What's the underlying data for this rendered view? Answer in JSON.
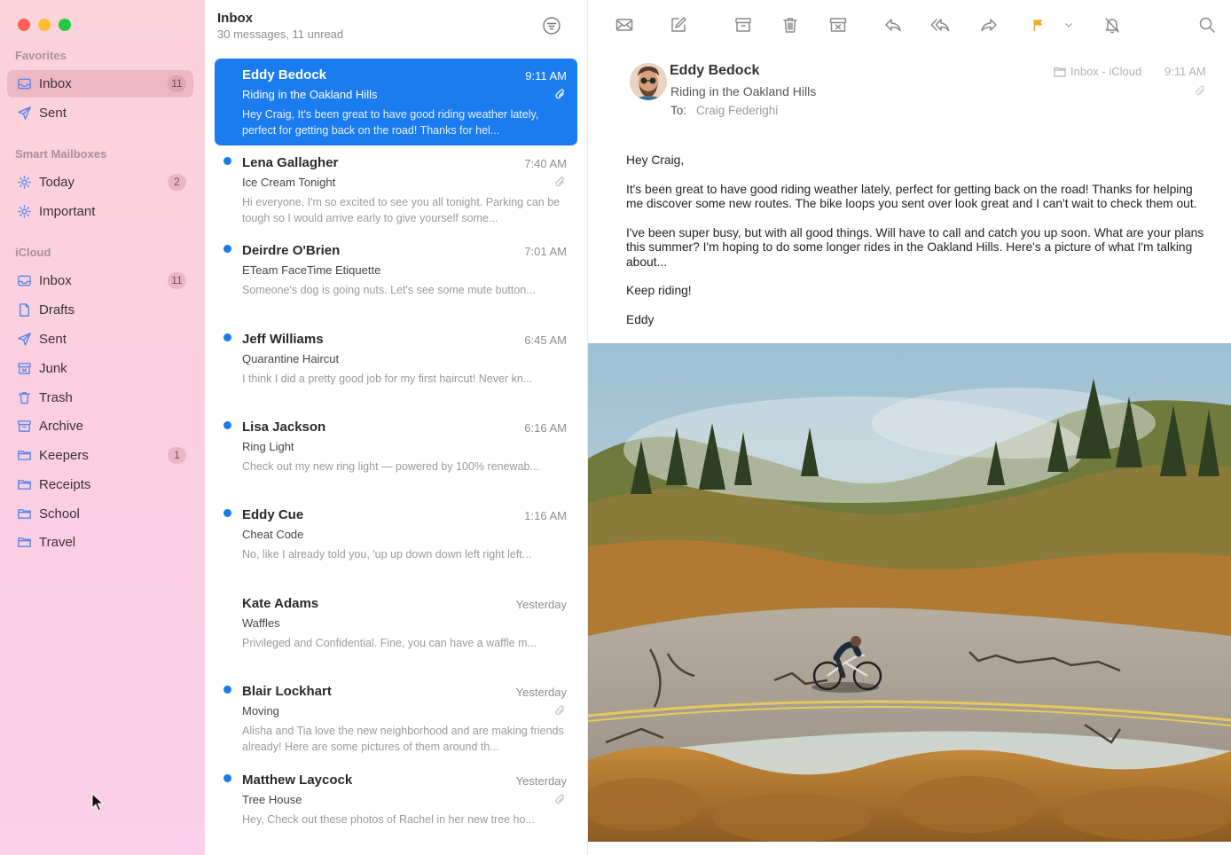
{
  "sidebar": {
    "sections": {
      "favorites": "Favorites",
      "smart": "Smart Mailboxes",
      "icloud": "iCloud"
    },
    "favorites": [
      {
        "label": "Inbox",
        "icon": "tray-icon",
        "badge": "11",
        "selected": true
      },
      {
        "label": "Sent",
        "icon": "paperplane-icon"
      }
    ],
    "smart": [
      {
        "label": "Today",
        "icon": "gear-icon",
        "badge": "2"
      },
      {
        "label": "Important",
        "icon": "gear-icon"
      }
    ],
    "icloud": [
      {
        "label": "Inbox",
        "icon": "tray-icon",
        "badge": "11"
      },
      {
        "label": "Drafts",
        "icon": "document-icon"
      },
      {
        "label": "Sent",
        "icon": "paperplane-icon"
      },
      {
        "label": "Junk",
        "icon": "junk-box-icon"
      },
      {
        "label": "Trash",
        "icon": "trash-icon"
      },
      {
        "label": "Archive",
        "icon": "archive-box-icon"
      },
      {
        "label": "Keepers",
        "icon": "folder-icon",
        "badge": "1"
      },
      {
        "label": "Receipts",
        "icon": "folder-icon"
      },
      {
        "label": "School",
        "icon": "folder-icon"
      },
      {
        "label": "Travel",
        "icon": "folder-icon"
      }
    ]
  },
  "list": {
    "title": "Inbox",
    "subtitle": "30 messages, 11 unread",
    "messages": [
      {
        "from": "Eddy Bedock",
        "time": "9:11 AM",
        "subject": "Riding in the Oakland Hills",
        "preview": "Hey Craig, It's been great to have good riding weather lately, perfect for getting back on the road! Thanks for hel...",
        "unread": false,
        "attachment": true,
        "selected": true
      },
      {
        "from": "Lena Gallagher",
        "time": "7:40 AM",
        "subject": "Ice Cream Tonight",
        "preview": "Hi everyone, I'm so excited to see you all tonight. Parking can be tough so I would arrive early to give yourself some...",
        "unread": true,
        "attachment": true
      },
      {
        "from": "Deirdre O'Brien",
        "time": "7:01 AM",
        "subject": "ETeam FaceTime Etiquette",
        "preview": "Someone's dog is going nuts. Let's see some mute button...",
        "unread": true,
        "attachment": false
      },
      {
        "from": "Jeff Williams",
        "time": "6:45 AM",
        "subject": "Quarantine Haircut",
        "preview": "I think I did a pretty good job for my first haircut! Never kn...",
        "unread": true,
        "attachment": false
      },
      {
        "from": "Lisa Jackson",
        "time": "6:16 AM",
        "subject": "Ring Light",
        "preview": "Check out my new ring light — powered by 100% renewab...",
        "unread": true,
        "attachment": false
      },
      {
        "from": "Eddy Cue",
        "time": "1:16 AM",
        "subject": "Cheat Code",
        "preview": "No, like I already told you, 'up up down down left right left...",
        "unread": true,
        "attachment": false
      },
      {
        "from": "Kate Adams",
        "time": "Yesterday",
        "subject": "Waffles",
        "preview": "Privileged and Confidential. Fine, you can have a waffle m...",
        "unread": false,
        "attachment": false
      },
      {
        "from": "Blair Lockhart",
        "time": "Yesterday",
        "subject": "Moving",
        "preview": "Alisha and Tia love the new neighborhood and are making friends already! Here are some pictures of them around th...",
        "unread": true,
        "attachment": true
      },
      {
        "from": "Matthew Laycock",
        "time": "Yesterday",
        "subject": "Tree House",
        "preview": "Hey, Check out these photos of Rachel in her new tree ho...",
        "unread": true,
        "attachment": true
      }
    ]
  },
  "reader": {
    "from": "Eddy Bedock",
    "subject": "Riding in the Oakland Hills",
    "to_label": "To:",
    "to": "Craig Federighi",
    "mailbox": "Inbox - iCloud",
    "time": "9:11 AM",
    "body": [
      "Hey Craig,",
      "It's been great to have good riding weather lately, perfect for getting back on the road! Thanks for helping me discover some new routes. The bike loops you sent over look great and I can't wait to check them out.",
      "I've been super busy, but with all good things. Will have to call and catch you up soon. What are your plans this summer? I'm hoping to do some longer rides in the Oakland Hills. Here's a picture of what I'm talking about...",
      "Keep riding!",
      "Eddy"
    ]
  },
  "toolbar": [
    "envelope-icon",
    "compose-icon",
    "archive-icon",
    "trash-icon",
    "junk-icon",
    "reply-icon",
    "reply-all-icon",
    "forward-icon",
    "flag-icon",
    "chevron-down-icon",
    "mute-bell-icon",
    "search-icon"
  ],
  "colors": {
    "accent": "#1b7cf0",
    "flag": "#f5a623",
    "sidebar_icon": "#5a86e8"
  }
}
